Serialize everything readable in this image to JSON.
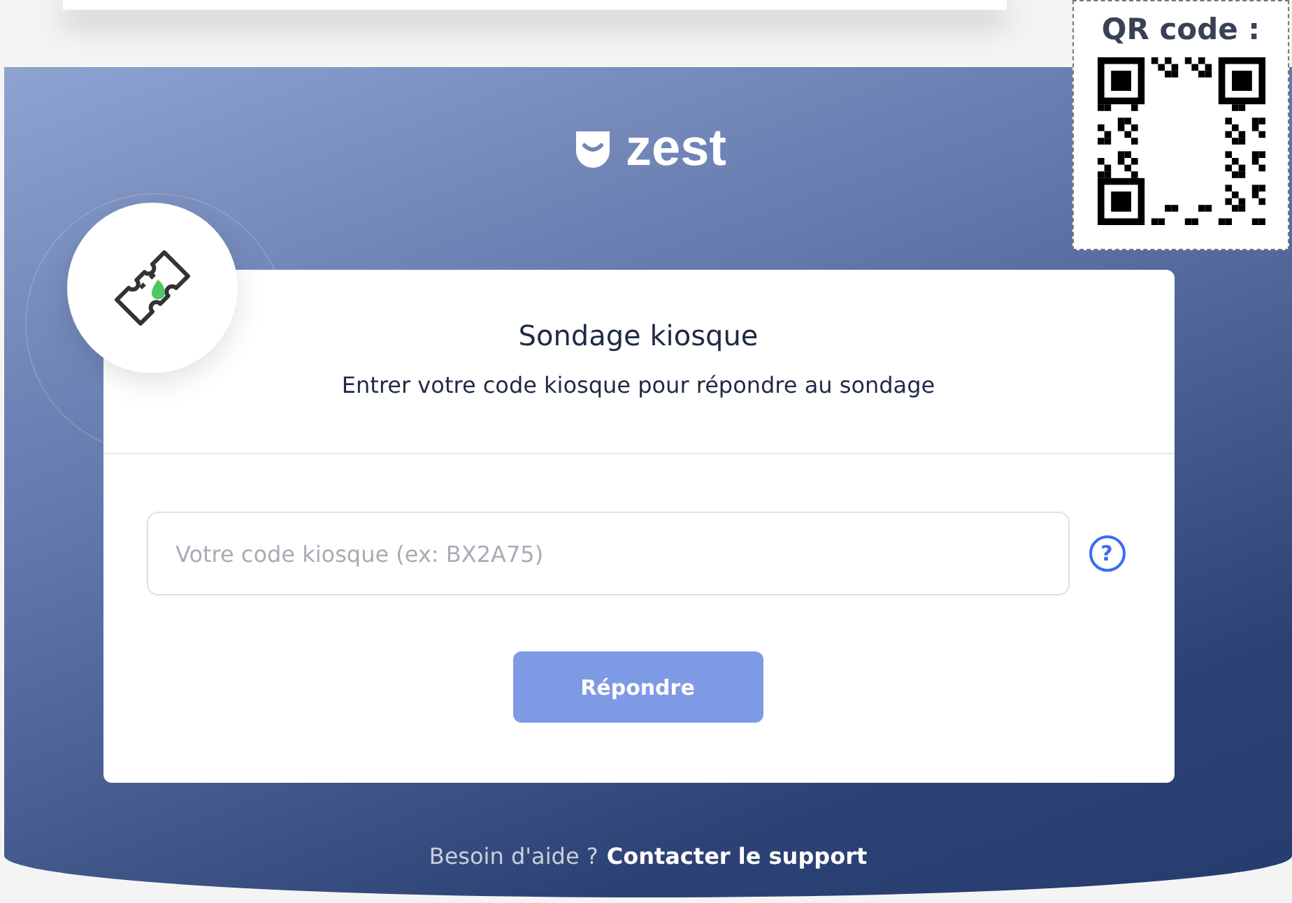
{
  "qr_overlay": {
    "label": "QR code :"
  },
  "logo": {
    "text": "zest"
  },
  "card": {
    "title": "Sondage kiosque",
    "subtitle": "Entrer votre code kiosque pour répondre au sondage",
    "code_field": {
      "placeholder": "Votre code kiosque (ex: BX2A75)"
    },
    "help_icon": "?",
    "submit_button": {
      "label": "Répondre",
      "disabled": true
    }
  },
  "footer": {
    "text": "Besoin d'aide ?",
    "link": "Contacter le support"
  }
}
